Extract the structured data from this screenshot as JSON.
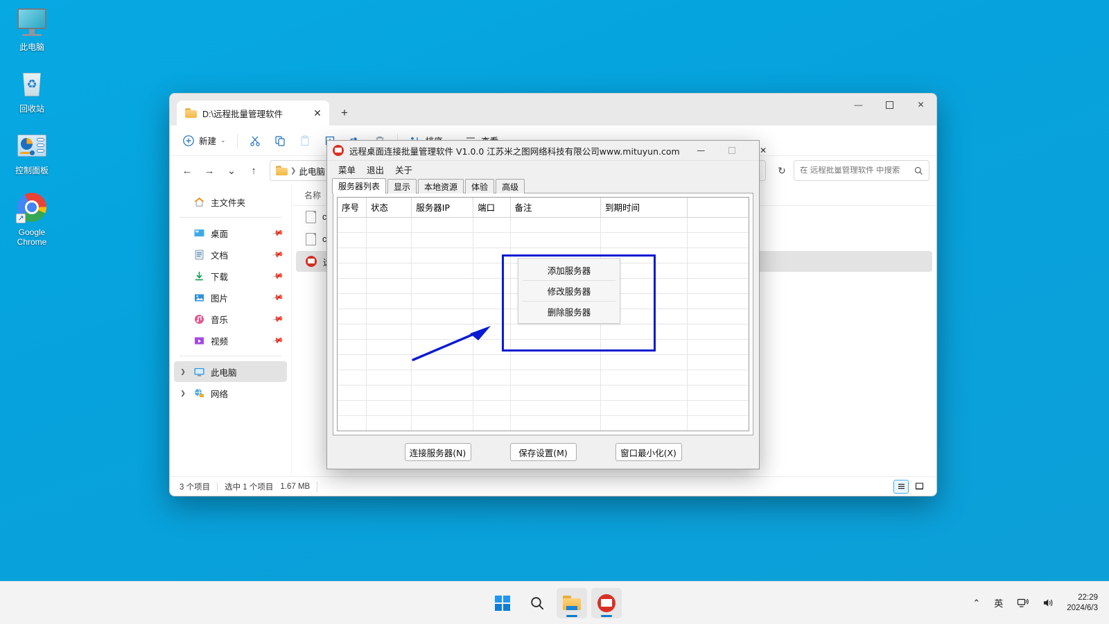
{
  "desktop": {
    "icons": [
      {
        "label": "此电脑",
        "icon": "this-pc-icon"
      },
      {
        "label": "回收站",
        "icon": "recycle-bin-icon"
      },
      {
        "label": "控制面板",
        "icon": "control-panel-icon"
      },
      {
        "label": "Google Chrome",
        "icon": "google-chrome-icon"
      }
    ]
  },
  "explorer": {
    "tab": {
      "title": "D:\\远程批量管理软件",
      "close_label": "✕",
      "new_tab_label": "+"
    },
    "window_controls": {
      "minimize": "—",
      "maximize": "▢",
      "close": "✕"
    },
    "toolbar": {
      "new_label": "新建",
      "sort_label": "排序",
      "view_label": "查看",
      "more_label": "···",
      "icons": [
        "cut-icon",
        "copy-icon",
        "paste-icon",
        "rename-icon",
        "share-icon",
        "delete-icon"
      ]
    },
    "nav": {
      "back": "←",
      "forward": "→",
      "recent": "⌄",
      "up": "↑",
      "breadcrumb": [
        "此电脑"
      ],
      "refresh": "↻"
    },
    "search": {
      "placeholder": "在 远程批量管理软件 中搜索",
      "value": ""
    },
    "sidebar": [
      {
        "label": "主文件夹",
        "icon": "home-icon",
        "pinned": false,
        "selected": false,
        "chevron": false
      },
      {
        "label": "桌面",
        "icon": "desktop-icon",
        "pinned": true,
        "selected": false,
        "chevron": false
      },
      {
        "label": "文档",
        "icon": "documents-icon",
        "pinned": true,
        "selected": false,
        "chevron": false
      },
      {
        "label": "下载",
        "icon": "downloads-icon",
        "pinned": true,
        "selected": false,
        "chevron": false
      },
      {
        "label": "图片",
        "icon": "pictures-icon",
        "pinned": true,
        "selected": false,
        "chevron": false
      },
      {
        "label": "音乐",
        "icon": "music-icon",
        "pinned": true,
        "selected": false,
        "chevron": false
      },
      {
        "label": "视频",
        "icon": "videos-icon",
        "pinned": true,
        "selected": false,
        "chevron": false
      },
      {
        "label": "此电脑",
        "icon": "this-pc-icon",
        "pinned": false,
        "selected": true,
        "chevron": true
      },
      {
        "label": "网络",
        "icon": "network-icon",
        "pinned": false,
        "selected": false,
        "chevron": true
      }
    ],
    "column_header": "名称",
    "files": [
      {
        "name": "config",
        "icon": "file-icon",
        "selected": false
      },
      {
        "name": "config",
        "icon": "file-icon",
        "selected": false
      },
      {
        "name": "远程桌",
        "icon": "app-icon",
        "selected": true
      }
    ],
    "status": {
      "items_count": "3 个项目",
      "selection": "选中 1 个项目",
      "size": "1.67 MB"
    },
    "view_buttons": {
      "details": "details-view",
      "tiles": "tiles-view"
    }
  },
  "rdp_app": {
    "title": "远程桌面连接批量管理软件 V1.0.0   江苏米之图网络科技有限公司www.mituyun.com",
    "window_controls": {
      "minimize": "—",
      "maximize": "▢",
      "close": "✕"
    },
    "menubar": [
      "菜单",
      "退出",
      "关于"
    ],
    "tabs": [
      {
        "label": "服务器列表",
        "active": true
      },
      {
        "label": "显示",
        "active": false
      },
      {
        "label": "本地资源",
        "active": false
      },
      {
        "label": "体验",
        "active": false
      },
      {
        "label": "高级",
        "active": false
      }
    ],
    "grid": {
      "columns": [
        "序号",
        "状态",
        "服务器IP",
        "端口",
        "备注",
        "到期时间",
        ""
      ],
      "column_widths": [
        "7%",
        "11%",
        "15%",
        "9%",
        "22%",
        "21%",
        "15%"
      ],
      "rows": [],
      "empty_row_count": 15
    },
    "footer_buttons": [
      "连接服务器(N)",
      "保存设置(M)",
      "窗口最小化(X)"
    ],
    "context_menu": {
      "items": [
        "添加服务器",
        "修改服务器",
        "删除服务器"
      ]
    },
    "annotation": {
      "color": "#0a1ad2",
      "shape": "rectangle-and-arrow"
    }
  },
  "taskbar": {
    "items": [
      {
        "name": "start-button",
        "icon": "windows-logo-icon",
        "running": false
      },
      {
        "name": "search-button",
        "icon": "search-icon",
        "running": false
      },
      {
        "name": "file-explorer-button",
        "icon": "folder-icon",
        "running": true
      },
      {
        "name": "rdp-app-button",
        "icon": "app-icon",
        "running": true
      }
    ],
    "tray": {
      "chevron": "⌃",
      "ime": "英",
      "network": "network-icon",
      "volume": "volume-icon",
      "time": "22:29",
      "date": "2024/6/3"
    }
  }
}
